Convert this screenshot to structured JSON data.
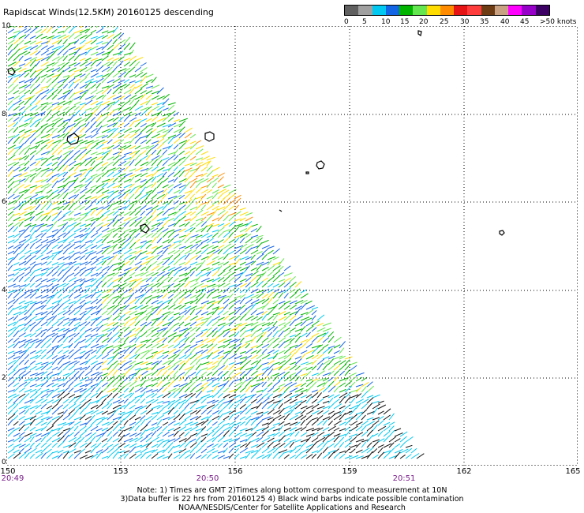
{
  "title": "Rapidscat Winds(12.5KM) 20160125 descending",
  "legend": {
    "labels": [
      "0",
      "5",
      "10",
      "15",
      "20",
      "25",
      "30",
      "35",
      "40",
      "45",
      ">50 knots"
    ],
    "colors": [
      "#606060",
      "#a0a0a0",
      "#00c8f0",
      "#1464e6",
      "#00b400",
      "#64e650",
      "#ffdc00",
      "#ff8c00",
      "#e61414",
      "#ff3c3c",
      "#6e3c14",
      "#c8a082",
      "#ff00ff",
      "#9600c8",
      "#3c0064"
    ]
  },
  "axes": {
    "x_labels": [
      "150",
      "153",
      "156",
      "159",
      "162",
      "165"
    ],
    "y_labels": [
      "10",
      "8",
      "6",
      "4",
      "2",
      "0"
    ],
    "time_labels": [
      "20:49",
      "20:50",
      "20:51"
    ]
  },
  "notes": {
    "line1": "Note: 1) Times are GMT 2)Times along bottom correspond to measurement at 10N",
    "line2": "3)Data buffer is 22 hrs from 20160125 4) Black wind barbs indicate possible contamination",
    "line3": "NOAA/NESDIS/Center for Satellite Applications and Research"
  }
}
